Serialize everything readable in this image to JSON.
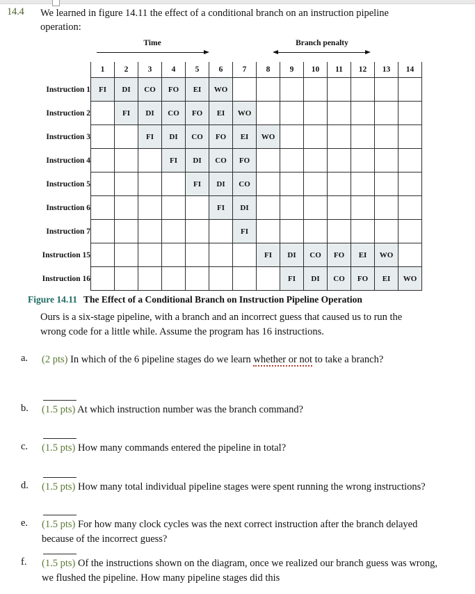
{
  "document": {
    "question_number": "14.4",
    "stem": "We learned in figure 14.11 the effect of a conditional branch on an instruction pipeline operation:",
    "figure_caption_label": "Figure 14.11",
    "figure_caption_text": "The Effect of a Conditional Branch on Instruction Pipeline Operation",
    "body_paragraph": "Ours is a six-stage pipeline, with a branch and an incorrect guess that caused us to run the wrong code for a little while. Assume the program has 16 instructions."
  },
  "diagram": {
    "time_label": "Time",
    "branch_penalty_label": "Branch penalty",
    "cycle_headers": [
      "1",
      "2",
      "3",
      "4",
      "5",
      "6",
      "7",
      "8",
      "9",
      "10",
      "11",
      "12",
      "13",
      "14"
    ],
    "row_labels": [
      "Instruction 1",
      "Instruction 2",
      "Instruction 3",
      "Instruction 4",
      "Instruction 5",
      "Instruction 6",
      "Instruction 7",
      "Instruction 15",
      "Instruction 16"
    ],
    "rows": [
      [
        "FI",
        "DI",
        "CO",
        "FO",
        "EI",
        "WO",
        "",
        "",
        "",
        "",
        "",
        "",
        "",
        ""
      ],
      [
        "",
        "FI",
        "DI",
        "CO",
        "FO",
        "EI",
        "WO",
        "",
        "",
        "",
        "",
        "",
        "",
        ""
      ],
      [
        "",
        "",
        "FI",
        "DI",
        "CO",
        "FO",
        "EI",
        "WO",
        "",
        "",
        "",
        "",
        "",
        ""
      ],
      [
        "",
        "",
        "",
        "FI",
        "DI",
        "CO",
        "FO",
        "",
        "",
        "",
        "",
        "",
        "",
        ""
      ],
      [
        "",
        "",
        "",
        "",
        "FI",
        "DI",
        "CO",
        "",
        "",
        "",
        "",
        "",
        "",
        ""
      ],
      [
        "",
        "",
        "",
        "",
        "",
        "FI",
        "DI",
        "",
        "",
        "",
        "",
        "",
        "",
        ""
      ],
      [
        "",
        "",
        "",
        "",
        "",
        "",
        "FI",
        "",
        "",
        "",
        "",
        "",
        "",
        ""
      ],
      [
        "",
        "",
        "",
        "",
        "",
        "",
        "",
        "FI",
        "DI",
        "CO",
        "FO",
        "EI",
        "WO",
        ""
      ],
      [
        "",
        "",
        "",
        "",
        "",
        "",
        "",
        "",
        "FI",
        "DI",
        "CO",
        "FO",
        "EI",
        "WO"
      ]
    ],
    "shaded_color": "#e7edee",
    "border_color": "#2c2c2c"
  },
  "questions": [
    {
      "letter": "a.",
      "points": "(2 pts)",
      "text_before": " In which of the 6 pipeline stages do we learn ",
      "emphasis": "whether or not",
      "text_after": " to take a branch?",
      "has_blank": false
    },
    {
      "letter": "b.",
      "points": "(1.5 pts)",
      "text_before": " At which instruction number was the branch command?",
      "emphasis": "",
      "text_after": "",
      "has_blank": true
    },
    {
      "letter": "c.",
      "points": "(1.5 pts)",
      "text_before": " How many commands entered the pipeline in total?",
      "emphasis": "",
      "text_after": "",
      "has_blank": true
    },
    {
      "letter": "d.",
      "points": "(1.5 pts)",
      "text_before": " How many total individual pipeline stages were spent running the wrong instructions?",
      "emphasis": "",
      "text_after": "",
      "has_blank": true
    },
    {
      "letter": "e.",
      "points": "(1.5 pts)",
      "text_before": " For how many clock cycles was the next correct instruction after the branch delayed because of the incorrect guess?",
      "emphasis": "",
      "text_after": "",
      "has_blank": true
    },
    {
      "letter": "f.",
      "points": "(1.5 pts)",
      "text_before": " Of the instructions shown on the diagram, once we realized our branch guess was wrong, we flushed the pipeline. How many pipeline stages did this",
      "emphasis": "",
      "text_after": "",
      "has_blank": true
    }
  ],
  "colors": {
    "question_number_green": "#4f6228",
    "points_green": "#5b7a33",
    "figure_label_teal": "#1f6b63"
  }
}
